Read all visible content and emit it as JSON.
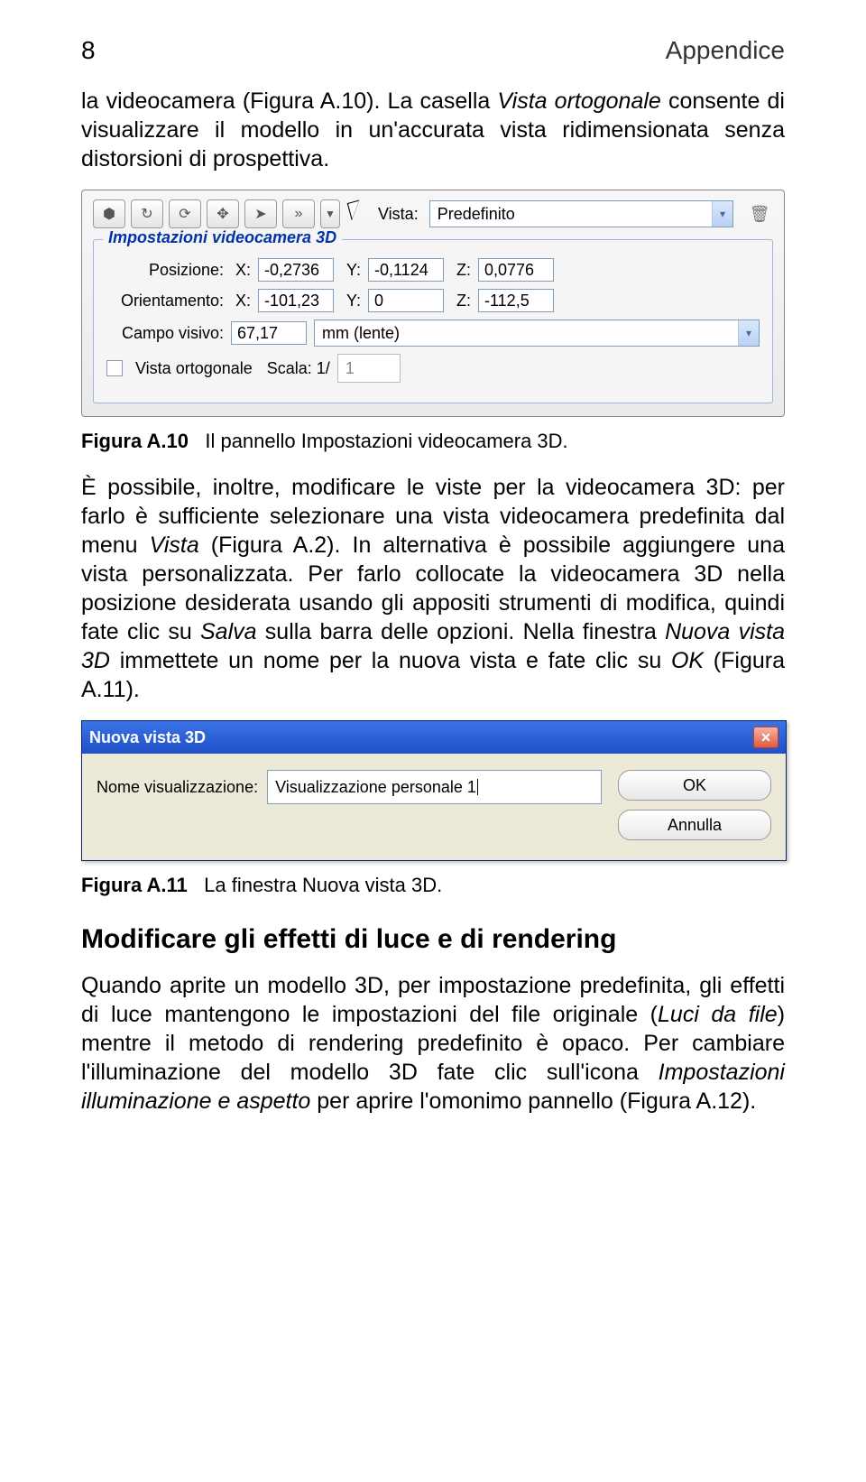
{
  "page": {
    "number": "8",
    "title": "Appendice"
  },
  "para1_a": "la videocamera (Figura A.10). La casella ",
  "para1_em1": "Vista ortogonale",
  "para1_b": " consente di visualizzare il modello in un'accurata vista ridimensionata senza distorsioni di prospettiva.",
  "fig1": {
    "toolbar": {
      "vista_label": "Vista:",
      "vista_value": "Predefinito"
    },
    "legend": "Impostazioni videocamera 3D",
    "labels": {
      "posizione": "Posizione:",
      "orientamento": "Orientamento:",
      "campo": "Campo visivo:",
      "x": "X:",
      "y": "Y:",
      "z": "Z:",
      "ortogonale": "Vista ortogonale",
      "scala": "Scala: 1/"
    },
    "pos": {
      "x": "-0,2736",
      "y": "-0,1124",
      "z": "0,0776"
    },
    "orient": {
      "x": "-101,23",
      "y": "0",
      "z": "-112,5"
    },
    "fov": {
      "value": "67,17",
      "units": "mm (lente)"
    },
    "scale_value": "1"
  },
  "caption1": {
    "bold": "Figura A.10",
    "rest": "Il pannello Impostazioni videocamera 3D."
  },
  "para2_a": "È possibile, inoltre, modificare le viste per la videocamera 3D: per farlo è sufficiente selezionare una vista videocamera predefinita dal menu ",
  "para2_em1": "Vista",
  "para2_b": " (Figura A.2). In alternativa è possibile aggiungere una vista personalizzata. Per farlo collocate la videocamera 3D nella posizione desiderata usando gli appositi strumenti di modifica, quindi fate clic su ",
  "para2_em2": "Salva",
  "para2_c": " sulla barra delle opzioni. Nella finestra ",
  "para2_em3": "Nuova vista 3D",
  "para2_d": " immettete un nome per la nuova vista e fate clic su ",
  "para2_em4": "OK",
  "para2_e": " (Figura A.11).",
  "dlg": {
    "title": "Nuova vista 3D",
    "label": "Nome visualizzazione:",
    "value": "Visualizzazione personale 1",
    "ok": "OK",
    "cancel": "Annulla"
  },
  "caption2": {
    "bold": "Figura A.11",
    "rest": "La finestra Nuova vista 3D."
  },
  "h2": "Modificare gli effetti di luce e di rendering",
  "para3_a": "Quando aprite un modello 3D, per impostazione predefinita, gli effetti di luce mantengono le impostazioni del file originale (",
  "para3_em1": "Luci da file",
  "para3_b": ") mentre il metodo di rendering predefinito è opaco. Per cambiare l'illuminazione del modello 3D fate clic sull'icona ",
  "para3_em2": "Impostazioni illuminazione e aspetto",
  "para3_c": " per aprire l'omonimo pannello (Figura A.12)."
}
